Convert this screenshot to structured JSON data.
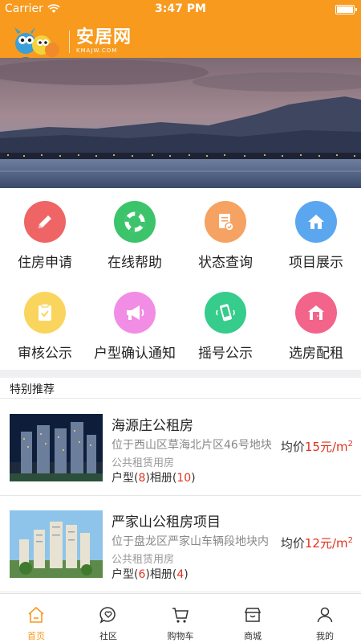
{
  "status_bar": {
    "carrier": "Carrier",
    "time": "3:47 PM"
  },
  "header": {
    "logo_cn": "安居网",
    "logo_en": "KMAJW.COM"
  },
  "colors": {
    "brand": "#f79a1e",
    "price_red": "#e0321e"
  },
  "services": [
    {
      "label": "住房申请",
      "icon": "pencil-icon",
      "color": "#ef6565"
    },
    {
      "label": "在线帮助",
      "icon": "lifebuoy-icon",
      "color": "#3cc46a"
    },
    {
      "label": "状态查询",
      "icon": "document-check-icon",
      "color": "#f5a262"
    },
    {
      "label": "项目展示",
      "icon": "home-icon",
      "color": "#5aa7f0"
    },
    {
      "label": "审核公示",
      "icon": "clipboard-check-icon",
      "color": "#fad55e"
    },
    {
      "label": "户型确认通知",
      "icon": "megaphone-icon",
      "color": "#f28de6"
    },
    {
      "label": "摇号公示",
      "icon": "phone-shake-icon",
      "color": "#36cc8b"
    },
    {
      "label": "选房配租",
      "icon": "house-door-icon",
      "color": "#f2648a"
    }
  ],
  "section": {
    "title": "特别推荐"
  },
  "listings": [
    {
      "title": "海源庄公租房",
      "address": "位于西山区草海北片区46号地块",
      "type": "公共租赁用房",
      "units_label": "户型",
      "units_count": "8",
      "album_label": "相册",
      "album_count": "10",
      "price_prefix": "均价",
      "price_value": "15元/m",
      "price_sup": "2"
    },
    {
      "title": "严家山公租房项目",
      "address": "位于盘龙区严家山车辆段地块内",
      "type": "公共租赁用房",
      "units_label": "户型",
      "units_count": "6",
      "album_label": "相册",
      "album_count": "4",
      "price_prefix": "均价",
      "price_value": "12元/m",
      "price_sup": "2"
    }
  ],
  "tabs": [
    {
      "label": "首页",
      "icon": "home-outline-icon",
      "active": true
    },
    {
      "label": "社区",
      "icon": "chat-heart-icon",
      "active": false
    },
    {
      "label": "购物车",
      "icon": "cart-icon",
      "active": false
    },
    {
      "label": "商城",
      "icon": "store-icon",
      "active": false
    },
    {
      "label": "我的",
      "icon": "user-icon",
      "active": false
    }
  ]
}
